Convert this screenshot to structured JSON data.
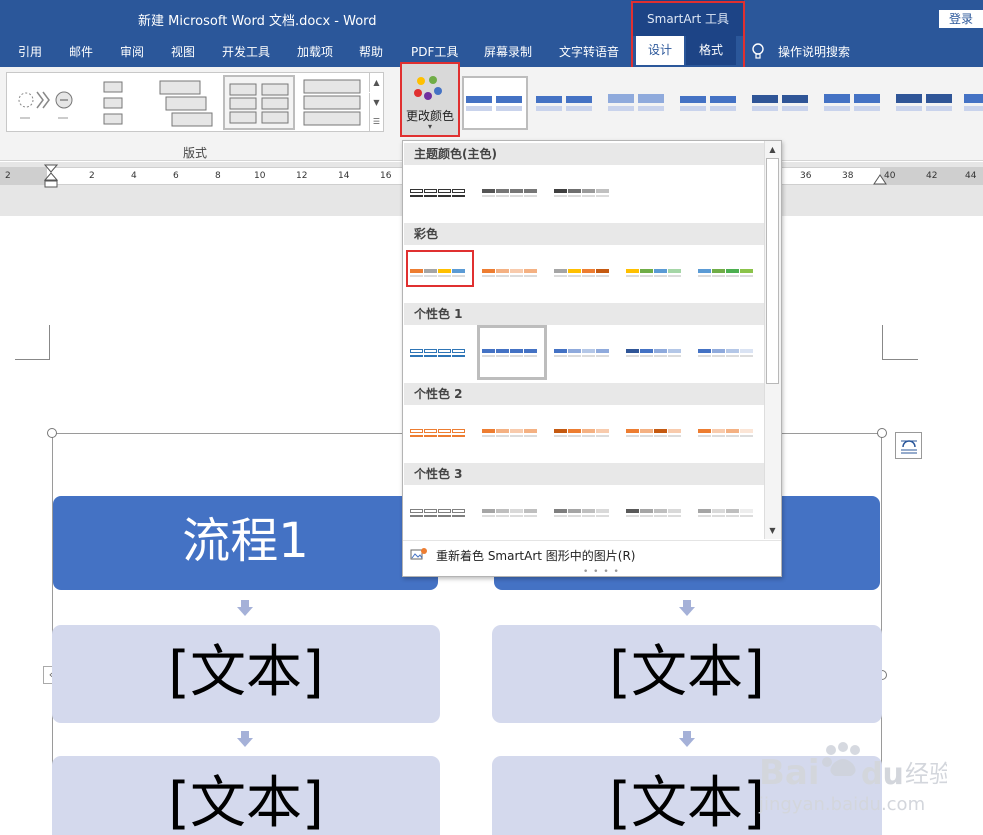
{
  "window": {
    "title": "新建 Microsoft Word 文档.docx  -  Word",
    "login": "登录"
  },
  "tabs": [
    "引用",
    "邮件",
    "审阅",
    "视图",
    "开发工具",
    "加载项",
    "帮助",
    "PDF工具",
    "屏幕录制",
    "文字转语音"
  ],
  "context_tab": {
    "group": "SmartArt 工具",
    "design": "设计",
    "format": "格式"
  },
  "tell_me": "操作说明搜索",
  "ribbon": {
    "layout_group_label": "版式",
    "change_colors_label": "更改颜色"
  },
  "ruler_numbers": [
    "2",
    "2",
    "4",
    "6",
    "8",
    "10",
    "12",
    "14",
    "16",
    "36",
    "38",
    "40",
    "42",
    "44"
  ],
  "dropdown": {
    "sections": [
      {
        "title": "主题颜色(主色)",
        "palettes": [
          [
            "#333333",
            "#333333",
            "#333333",
            "#333333"
          ],
          [
            "#555555",
            "#777777",
            "#777777",
            "#777777"
          ],
          [
            "#404040",
            "#6f6f6f",
            "#9a9a9a",
            "#c0c0c0"
          ]
        ]
      },
      {
        "title": "彩色",
        "palettes": [
          [
            "#ed7d31",
            "#a5a5a5",
            "#ffc000",
            "#5b9bd5"
          ],
          [
            "#ed7d31",
            "#f4b183",
            "#f8cbad",
            "#f4b183"
          ],
          [
            "#a5a5a5",
            "#ffc000",
            "#ed7d31",
            "#c55a11"
          ],
          [
            "#ffc000",
            "#70ad47",
            "#5b9bd5",
            "#a5d6a7"
          ],
          [
            "#5b9bd5",
            "#70ad47",
            "#4caf50",
            "#8bc34a"
          ]
        ]
      },
      {
        "title": "个性色 1",
        "palettes": [
          [
            "#2e75b6",
            "#2e75b6",
            "#2e75b6",
            "#2e75b6"
          ],
          [
            "#4472c4",
            "#4472c4",
            "#4472c4",
            "#4472c4"
          ],
          [
            "#4472c4",
            "#8faadc",
            "#b4c7e7",
            "#8faadc"
          ],
          [
            "#2f5597",
            "#4472c4",
            "#8faadc",
            "#b4c7e7"
          ],
          [
            "#4472c4",
            "#8faadc",
            "#b4c7e7",
            "#dae3f3"
          ]
        ]
      },
      {
        "title": "个性色 2",
        "palettes": [
          [
            "#ed7d31",
            "#ed7d31",
            "#ed7d31",
            "#ed7d31"
          ],
          [
            "#ed7d31",
            "#f4b183",
            "#f8cbad",
            "#f4b183"
          ],
          [
            "#c55a11",
            "#ed7d31",
            "#f4b183",
            "#f8cbad"
          ],
          [
            "#ed7d31",
            "#f4b183",
            "#c55a11",
            "#f8cbad"
          ],
          [
            "#ed7d31",
            "#f8cbad",
            "#f4b183",
            "#fbe5d6"
          ]
        ]
      },
      {
        "title": "个性色 3",
        "palettes": [
          [
            "#7f7f7f",
            "#7f7f7f",
            "#7f7f7f",
            "#7f7f7f"
          ],
          [
            "#a5a5a5",
            "#bfbfbf",
            "#d9d9d9",
            "#bfbfbf"
          ],
          [
            "#7f7f7f",
            "#a5a5a5",
            "#bfbfbf",
            "#d9d9d9"
          ],
          [
            "#595959",
            "#a5a5a5",
            "#bfbfbf",
            "#d9d9d9"
          ],
          [
            "#a5a5a5",
            "#d9d9d9",
            "#bfbfbf",
            "#ededed"
          ]
        ]
      }
    ],
    "recolor_pictures": "重新着色 SmartArt 图形中的图片(R)"
  },
  "smartart": {
    "header_left": "流程1",
    "cells": [
      "[文本]",
      "[文本]",
      "[文本]",
      "[文本]"
    ]
  },
  "colors": {
    "ribbon_blue": "#2b579a",
    "accent": "#4472c4",
    "box_fill": "#d4d9ed",
    "highlight_red": "#e03030"
  }
}
